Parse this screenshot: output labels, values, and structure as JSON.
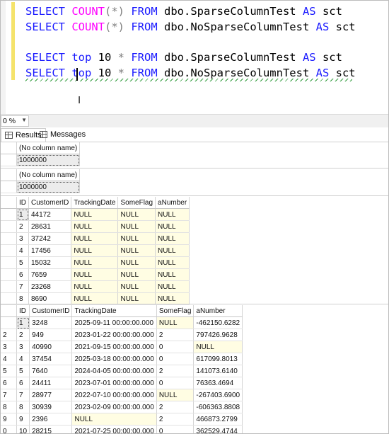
{
  "editor": {
    "lines": [
      {
        "select": "SELECT ",
        "fn": "COUNT",
        "paren": "(*)",
        "from": " FROM ",
        "table": "dbo.SparseColumnTest ",
        "as": "AS",
        "alias": " sct"
      },
      {
        "select": "SELECT ",
        "fn": "COUNT",
        "paren": "(*)",
        "from": " FROM ",
        "table": "dbo.NoSparseColumnTest ",
        "as": "AS",
        "alias": " sct"
      },
      {
        "select": "SELECT ",
        "top": "top",
        "num": " 10 ",
        "star": "*",
        "from": " FROM ",
        "table": "dbo.SparseColumnTest ",
        "as": "AS",
        "alias": " sct"
      },
      {
        "select": "SELECT ",
        "top": "top",
        "num": " 10 ",
        "star": "*",
        "from": " FROM ",
        "table": "dbo.NoSparseColumnTest ",
        "as": "AS",
        "alias": " sct"
      }
    ]
  },
  "zoom": {
    "value": "0 %"
  },
  "tabs": {
    "results": "Results",
    "messages": "Messages"
  },
  "grid1": {
    "header": "(No column name)",
    "value": "1000000"
  },
  "grid2": {
    "header": "(No column name)",
    "value": "1000000"
  },
  "grid3": {
    "columns": [
      "ID",
      "CustomerID",
      "TrackingDate",
      "SomeFlag",
      "aNumber"
    ],
    "rows": [
      [
        "1",
        "44172",
        "NULL",
        "NULL",
        "NULL"
      ],
      [
        "2",
        "28631",
        "NULL",
        "NULL",
        "NULL"
      ],
      [
        "3",
        "37242",
        "NULL",
        "NULL",
        "NULL"
      ],
      [
        "4",
        "17456",
        "NULL",
        "NULL",
        "NULL"
      ],
      [
        "5",
        "15032",
        "NULL",
        "NULL",
        "NULL"
      ],
      [
        "6",
        "7659",
        "NULL",
        "NULL",
        "NULL"
      ],
      [
        "7",
        "23268",
        "NULL",
        "NULL",
        "NULL"
      ],
      [
        "8",
        "8690",
        "NULL",
        "NULL",
        "NULL"
      ]
    ]
  },
  "grid4": {
    "columns": [
      "ID",
      "CustomerID",
      "TrackingDate",
      "SomeFlag",
      "aNumber"
    ],
    "rows": [
      [
        "1",
        "3248",
        "2025-09-11 00:00:00.000",
        "NULL",
        "-462150.6282"
      ],
      [
        "2",
        "949",
        "2023-01-22 00:00:00.000",
        "2",
        "797426.9628"
      ],
      [
        "3",
        "40990",
        "2021-09-15 00:00:00.000",
        "0",
        "NULL"
      ],
      [
        "4",
        "37454",
        "2025-03-18 00:00:00.000",
        "0",
        "617099.8013"
      ],
      [
        "5",
        "7640",
        "2024-04-05 00:00:00.000",
        "2",
        "141073.6140"
      ],
      [
        "6",
        "24411",
        "2023-07-01 00:00:00.000",
        "0",
        "76363.4694"
      ],
      [
        "7",
        "28977",
        "2022-07-10 00:00:00.000",
        "NULL",
        "-267403.6900"
      ],
      [
        "8",
        "30939",
        "2023-02-09 00:00:00.000",
        "2",
        "-606363.8808"
      ],
      [
        "9",
        "2396",
        "NULL",
        "2",
        "466873.2799"
      ],
      [
        "10",
        "28215",
        "2021-07-25 00:00:00.000",
        "0",
        "362529.4744"
      ]
    ]
  },
  "edge_marks": {
    "grid4": [
      "2",
      "3",
      "4",
      "5",
      "6",
      "7",
      "8",
      "9",
      "0"
    ]
  }
}
